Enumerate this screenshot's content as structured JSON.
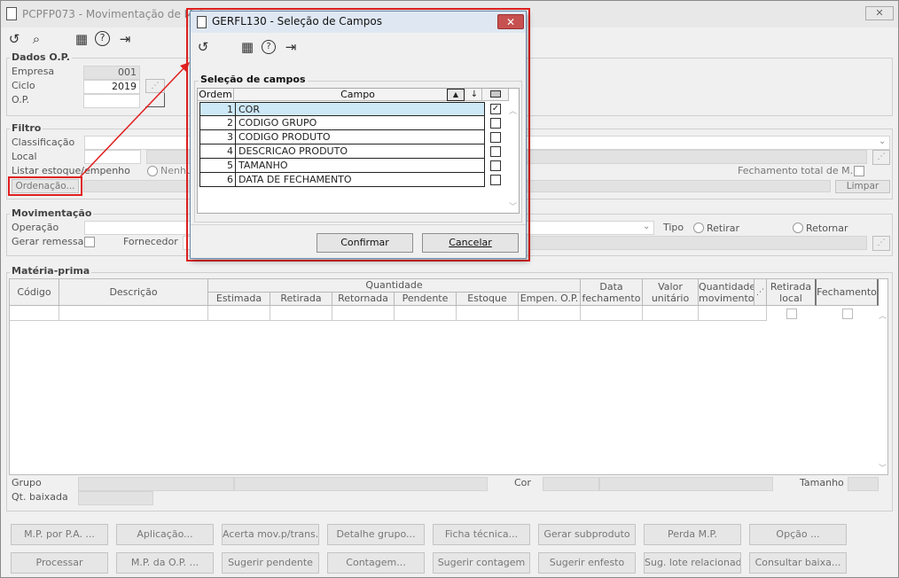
{
  "main": {
    "title": "PCPFP073 - Movimentação de Mat",
    "toolbar": [
      "↺",
      "⌕",
      "▦",
      "?",
      "⇥"
    ],
    "dados_op": {
      "label": "Dados O.P.",
      "empresa_label": "Empresa",
      "empresa_value": "001",
      "ciclo_label": "Ciclo",
      "ciclo_value": "2019",
      "op_label": "O.P.",
      "op_value": ""
    },
    "filtro": {
      "label": "Filtro",
      "classificacao_label": "Classificação",
      "local_label": "Local",
      "listar_label": "Listar estoque/empenho",
      "radio_nenhum": "Nenhu",
      "fechamento_total_label": "Fechamento total de M.P.",
      "ordenacao_button": "Ordenação...",
      "limpar_button": "Limpar"
    },
    "movimentacao": {
      "label": "Movimentação",
      "operacao_label": "Operação",
      "tipo_label": "Tipo",
      "retirar_label": "Retirar",
      "retornar_label": "Retornar",
      "gerar_remessa_label": "Gerar remessa",
      "fornecedor_label": "Fornecedor"
    },
    "materia_prima": {
      "label": "Matéria-prima",
      "col_codigo": "Código",
      "col_descricao": "Descrição",
      "col_quantidade": "Quantidade",
      "sub_cols": [
        "Estimada",
        "Retirada",
        "Retornada",
        "Pendente",
        "Estoque",
        "Empen. O.P."
      ],
      "col_data_fech_1": "Data",
      "col_data_fech_2": "fechamento",
      "col_valor_1": "Valor",
      "col_valor_2": "unitário",
      "col_qtd_mov_1": "Quantidade",
      "col_qtd_mov_2": "movimento",
      "col_retirada_1": "Retirada",
      "col_retirada_2": "local",
      "col_fechamento": "Fechamento",
      "grupo_label": "Grupo",
      "cor_label": "Cor",
      "tamanho_label": "Tamanho",
      "qt_baixada_label": "Qt. baixada"
    },
    "buttons_row1": [
      "M.P. por P.A. ...",
      "Aplicação...",
      "Acerta mov.p/trans.",
      "Detalhe grupo...",
      "Ficha técnica...",
      "Gerar subproduto",
      "Perda M.P.",
      "Opção ..."
    ],
    "buttons_row2": [
      "Processar",
      "M.P. da O.P. ...",
      "Sugerir pendente",
      "Contagem...",
      "Sugerir contagem",
      "Sugerir enfesto",
      "Sug. lote relacionado",
      "Consultar baixa..."
    ]
  },
  "dialog": {
    "title": "GERFL130 - Seleção de Campos",
    "close": "✕",
    "toolbar": [
      "↺",
      "▦",
      "?",
      "⇥"
    ],
    "group_label": "Seleção de campos",
    "col_ordem": "Ordem",
    "col_campo": "Campo",
    "sort_asc": "▲",
    "sort_desc": "↓",
    "rows": [
      {
        "ordem": "1",
        "campo": "COR",
        "checked": true
      },
      {
        "ordem": "2",
        "campo": "CODIGO GRUPO",
        "checked": false
      },
      {
        "ordem": "3",
        "campo": "CODIGO PRODUTO",
        "checked": false
      },
      {
        "ordem": "4",
        "campo": "DESCRICAO PRODUTO",
        "checked": false
      },
      {
        "ordem": "5",
        "campo": "TAMANHO",
        "checked": false
      },
      {
        "ordem": "6",
        "campo": "DATA DE FECHAMENTO",
        "checked": false
      }
    ],
    "confirm_button": "Confirmar",
    "cancel_button": "Cancelar"
  },
  "colors": {
    "highlight": "#e02020",
    "selected_row": "#cde8f7"
  }
}
